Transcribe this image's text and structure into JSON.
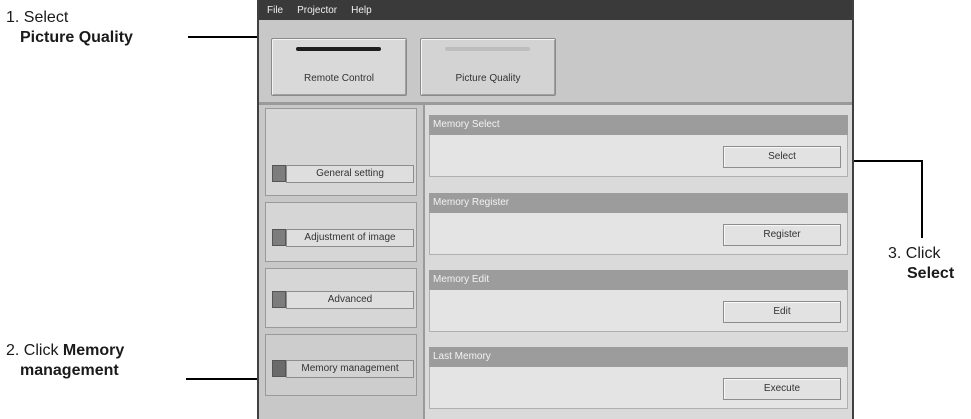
{
  "callouts": {
    "step1": {
      "number": "1. Select",
      "emphasis": "Picture Quality"
    },
    "step2": {
      "number": "2. Click",
      "emphasis": "Memory",
      "emphasis2": "management"
    },
    "step3": {
      "number": "3. Click",
      "emphasis": "Select"
    }
  },
  "menubar": [
    "File",
    "Projector",
    "Help"
  ],
  "toolbar": {
    "remote_label": "Remote Control",
    "picture_quality_label": "Picture Quality"
  },
  "sidebar": {
    "items": [
      {
        "label": "General setting"
      },
      {
        "label": "Adjustment of image"
      },
      {
        "label": "Advanced"
      },
      {
        "label": "Memory management"
      }
    ]
  },
  "sections": [
    {
      "title": "Memory Select",
      "button": "Select"
    },
    {
      "title": "Memory Register",
      "button": "Register"
    },
    {
      "title": "Memory Edit",
      "button": "Edit"
    },
    {
      "title": "Last Memory",
      "button": "Execute"
    }
  ]
}
